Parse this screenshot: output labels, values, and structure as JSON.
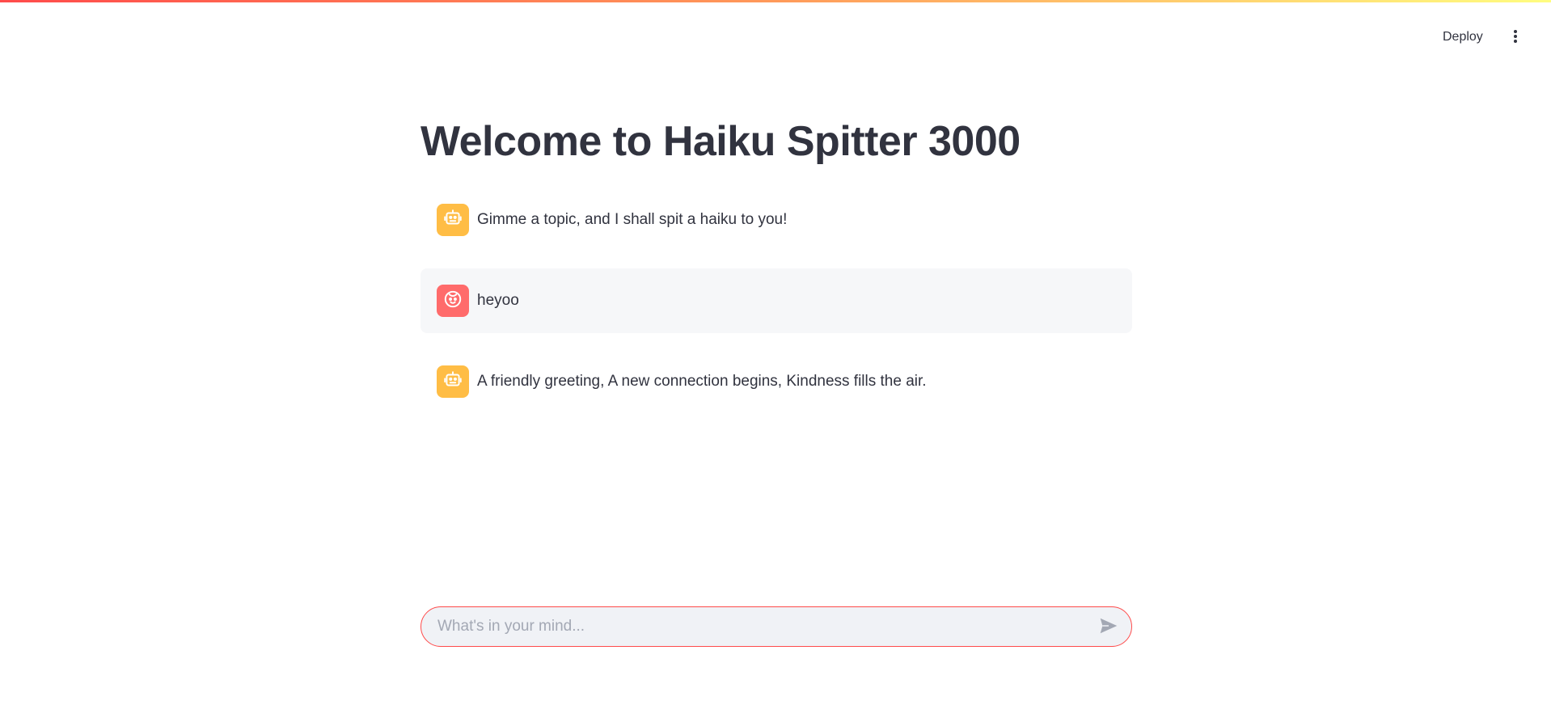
{
  "header": {
    "deploy_label": "Deploy",
    "menu_icon": "vertical-ellipsis-icon"
  },
  "main": {
    "title": "Welcome to Haiku Spitter 3000"
  },
  "messages": [
    {
      "role": "assistant",
      "avatar_icon": "robot-icon",
      "text": "Gimme a topic, and I shall spit a haiku to you!"
    },
    {
      "role": "user",
      "avatar_icon": "smiley-face-icon",
      "text": "heyoo"
    },
    {
      "role": "assistant",
      "avatar_icon": "robot-icon",
      "text": "A friendly greeting, A new connection begins, Kindness fills the air."
    }
  ],
  "chat_input": {
    "placeholder": "What's in your mind...",
    "value": "",
    "send_icon": "send-arrow-icon"
  },
  "colors": {
    "accent": "#ff4b4b",
    "assistant_avatar": "#ffbd45",
    "user_avatar": "#ff6b6b",
    "user_message_bg": "#f6f7f9",
    "text": "#31333f"
  }
}
